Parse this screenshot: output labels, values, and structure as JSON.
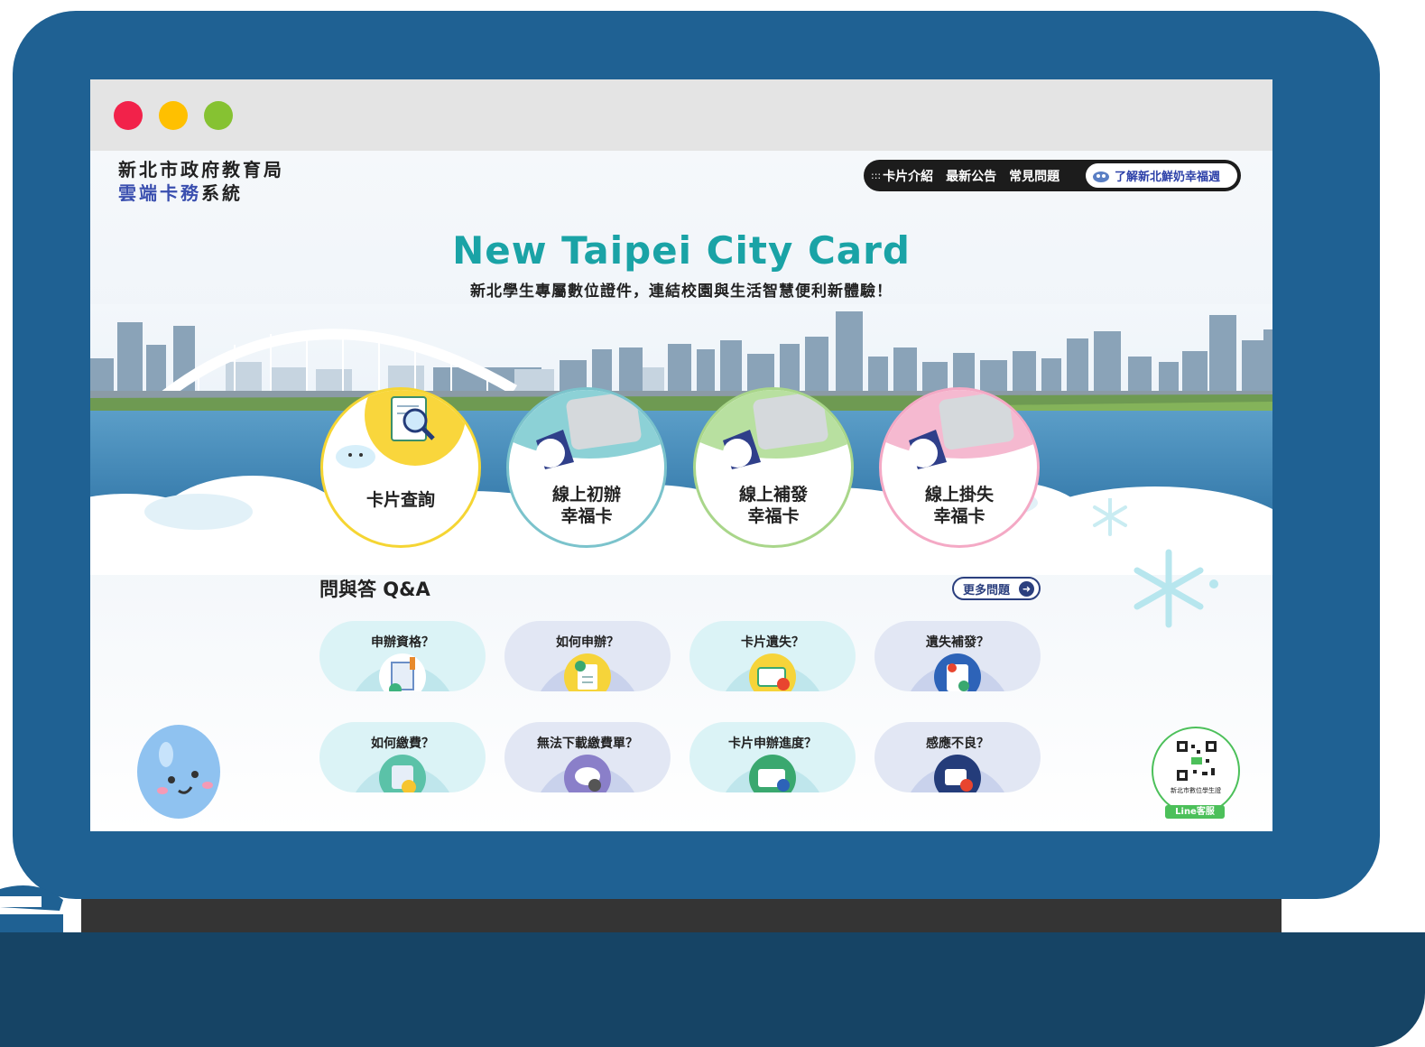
{
  "header": {
    "logo_line1": "新北市政府教育局",
    "logo_line2_blue": "雲端卡務",
    "logo_line2_dark": "系統"
  },
  "nav": {
    "items": [
      "卡片介紹",
      "最新公告",
      "常見問題"
    ],
    "highlight": "了解新北鮮奶幸福週"
  },
  "hero": {
    "title": "New Taipei City Card",
    "subtitle": "新北學生專屬數位證件，連結校園與生活智慧便利新體驗！"
  },
  "services": [
    {
      "line1": "卡片查詢",
      "line2": ""
    },
    {
      "line1": "線上初辦",
      "line2": "幸福卡"
    },
    {
      "line1": "線上補發",
      "line2": "幸福卡"
    },
    {
      "line1": "線上掛失",
      "line2": "幸福卡"
    }
  ],
  "qa": {
    "title": "問與答 Q&A",
    "more": "更多問題",
    "items": [
      "申辦資格？",
      "如何申辦？",
      "卡片遺失？",
      "遺失補發？",
      "如何繳費？",
      "無法下載繳費單？",
      "卡片申辦進度？",
      "感應不良？"
    ]
  },
  "line_service": {
    "caption": "新北市數位學生證",
    "tag": "Line客服"
  },
  "colors": {
    "frame": "#1f6193",
    "base": "#164465",
    "title_teal": "#1aa3a6",
    "accent_blue": "#3a4faf"
  }
}
